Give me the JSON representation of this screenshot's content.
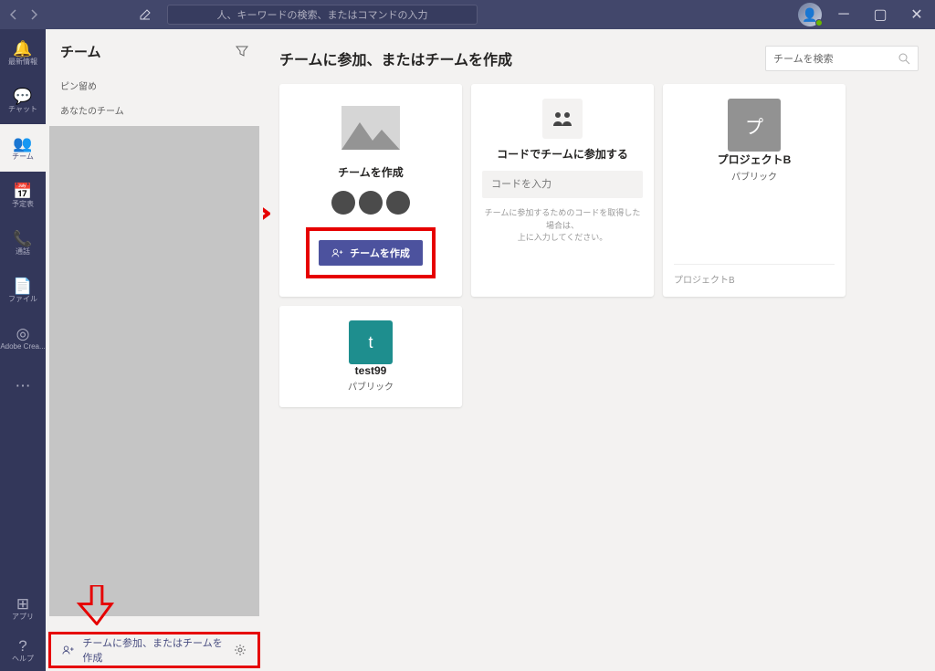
{
  "titlebar": {
    "search_placeholder": "人、キーワードの検索、またはコマンドの入力"
  },
  "rail": {
    "items": [
      {
        "icon": "🔔",
        "label": "最新情報"
      },
      {
        "icon": "💬",
        "label": "チャット"
      },
      {
        "icon": "👥",
        "label": "チーム"
      },
      {
        "icon": "📅",
        "label": "予定表"
      },
      {
        "icon": "📞",
        "label": "通話"
      },
      {
        "icon": "📄",
        "label": "ファイル"
      },
      {
        "icon": "◎",
        "label": "Adobe Crea..."
      },
      {
        "icon": "⋯",
        "label": ""
      }
    ],
    "bottom": [
      {
        "icon": "⊞",
        "label": "アプリ"
      },
      {
        "icon": "?",
        "label": "ヘルプ"
      }
    ]
  },
  "panel": {
    "title": "チーム",
    "pinned_label": "ピン留め",
    "your_teams_label": "あなたのチーム",
    "footer_label": "チームに参加、またはチームを作成"
  },
  "main": {
    "title": "チームに参加、またはチームを作成",
    "search_placeholder": "チームを検索",
    "create_card": {
      "title": "チームを作成",
      "button": "チームを作成"
    },
    "code_card": {
      "title": "コードでチームに参加する",
      "placeholder": "コードを入力",
      "hint1": "チームに参加するためのコードを取得した場合は、",
      "hint2": "上に入力してください。"
    },
    "team_cards": [
      {
        "initial": "プ",
        "name": "プロジェクトB",
        "type": "パブリック",
        "desc": "プロジェクトB",
        "color": "#929292"
      },
      {
        "initial": "t",
        "name": "test99",
        "type": "パブリック",
        "desc": "",
        "color": "#1e8e8e"
      }
    ]
  }
}
